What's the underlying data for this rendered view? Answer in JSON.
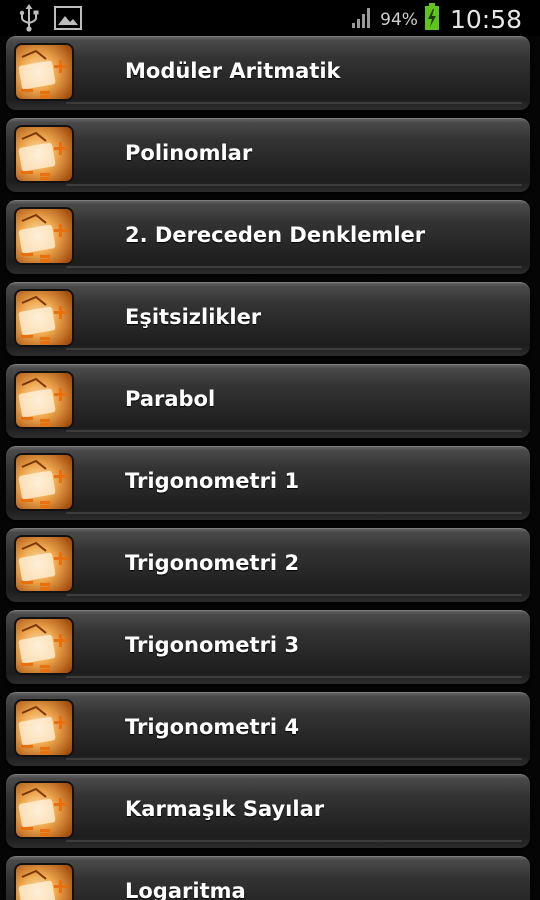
{
  "status_bar": {
    "left_icons": [
      "usb-icon",
      "image-icon"
    ],
    "battery_percent": "94%",
    "time": "10:58",
    "colors": {
      "battery_fill": "#5fc31c",
      "text": "#e6e6e6"
    }
  },
  "menu": {
    "item_icon": "math-book-icon",
    "items": [
      {
        "label": "Modüler Aritmatik"
      },
      {
        "label": "Polinomlar"
      },
      {
        "label": "2. Dereceden Denklemler"
      },
      {
        "label": "Eşitsizlikler"
      },
      {
        "label": "Parabol"
      },
      {
        "label": "Trigonometri 1"
      },
      {
        "label": "Trigonometri 2"
      },
      {
        "label": "Trigonometri 3"
      },
      {
        "label": "Trigonometri 4"
      },
      {
        "label": "Karmaşık Sayılar"
      },
      {
        "label": "Logaritma"
      }
    ]
  },
  "colors": {
    "background": "#050505",
    "item_gradient_top": "#4a4a4a",
    "item_gradient_bottom": "#1d1d1d",
    "label": "#ffffff",
    "icon_orange": "#e98a2a"
  }
}
